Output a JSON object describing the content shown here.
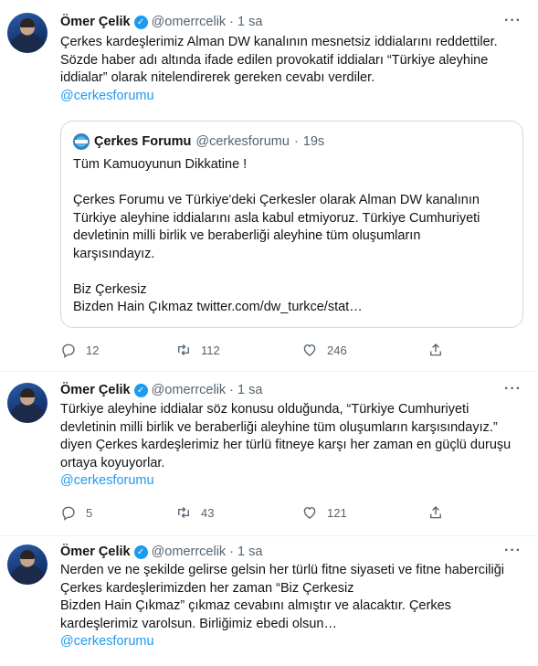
{
  "tweets": [
    {
      "author": {
        "name": "Ömer Çelik",
        "handle": "@omerrcelik",
        "separator": "·",
        "time": "1 sa"
      },
      "more": "···",
      "lines": [
        "Çerkes kardeşlerimiz Alman DW kanalının mesnetsiz iddialarını reddettiler.",
        "Sözde haber adı altında ifade edilen provokatif iddiaları “Türkiye aleyhine",
        "iddialar” olarak nitelendirerek gereken cevabı verdiler."
      ],
      "mention": "@cerkesforumu",
      "quote": {
        "author": {
          "name": "Çerkes Forumu",
          "handle": "@cerkesforumu",
          "separator": "·",
          "time": "19s"
        },
        "lines": [
          "Tüm Kamuoyunun Dikkatine !",
          "",
          "Çerkes Forumu ve Türkiye'deki Çerkesler  olarak Alman DW kanalının",
          "Türkiye aleyhine iddialarını asla kabul etmiyoruz.  Türkiye Cumhuriyeti",
          "devletinin  milli birlik ve beraberliği aleyhine  tüm oluşumların",
          "karşısındayız.",
          "",
          "Biz Çerkesiz",
          "Bizden Hain Çıkmaz twitter.com/dw_turkce/stat…"
        ]
      },
      "stats": {
        "replies": "12",
        "retweets": "112",
        "likes": "246"
      }
    },
    {
      "author": {
        "name": "Ömer Çelik",
        "handle": "@omerrcelik",
        "separator": "·",
        "time": "1 sa"
      },
      "more": "···",
      "lines": [
        "Türkiye aleyhine iddialar söz konusu  olduğunda, “Türkiye Cumhuriyeti",
        "devletinin  milli birlik ve beraberliği aleyhine  tüm oluşumların karşısındayız.”",
        "diyen Çerkes kardeşlerimiz her türlü fitneye karşı her zaman en güçlü duruşu",
        "ortaya koyuyorlar."
      ],
      "mention": "@cerkesforumu",
      "stats": {
        "replies": "5",
        "retweets": "43",
        "likes": "121"
      }
    },
    {
      "author": {
        "name": "Ömer Çelik",
        "handle": "@omerrcelik",
        "separator": "·",
        "time": "1 sa"
      },
      "more": "···",
      "lines": [
        "Nerden ve ne şekilde gelirse gelsin her türlü fitne siyaseti ve fitne haberciliği",
        "Çerkes kardeşlerimizden her zaman “Biz Çerkesiz",
        "Bizden Hain Çıkmaz” çıkmaz cevabını almıştır ve alacaktır. Çerkes",
        "kardeşlerimiz varolsun. Birliğimiz ebedi olsun…"
      ],
      "mention": "@cerkesforumu"
    }
  ],
  "icons": {
    "verified": "verified-badge-icon",
    "reply": "reply-icon",
    "retweet": "retweet-icon",
    "like": "heart-icon",
    "share": "share-icon"
  },
  "colors": {
    "accent": "#1d9bf0",
    "secondary_text": "#536471",
    "border": "#cfd9de",
    "divider": "#eff3f4"
  }
}
